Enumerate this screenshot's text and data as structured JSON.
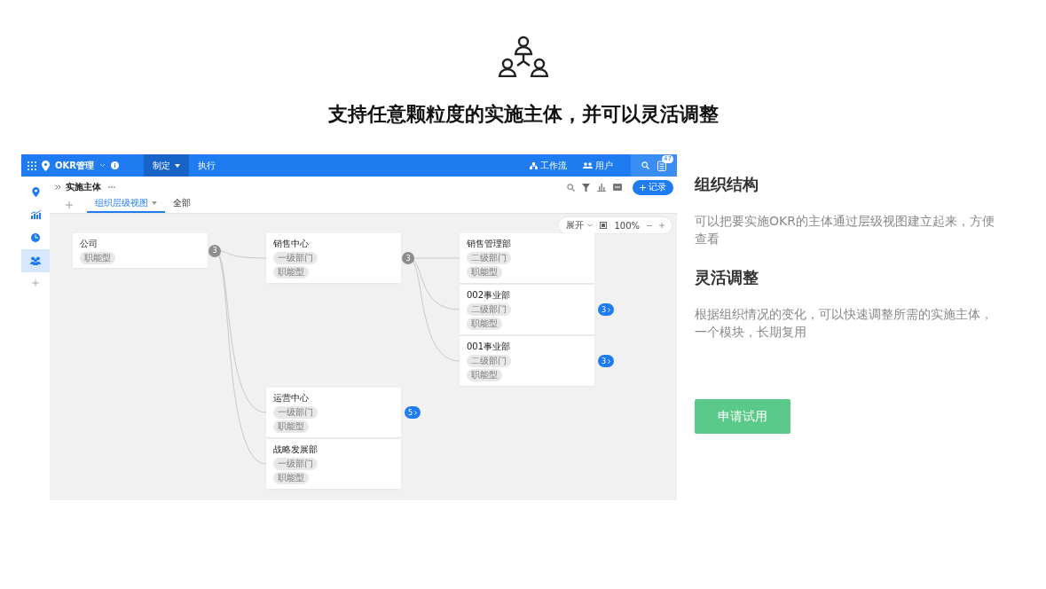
{
  "hero": {
    "title": "支持任意颗粒度的实施主体，并可以灵活调整"
  },
  "app": {
    "brand": "OKR管理",
    "nav": [
      {
        "label": "制定",
        "selected": true
      },
      {
        "label": "执行",
        "selected": false
      }
    ],
    "top_links": [
      {
        "kind": "workflow",
        "label": "工作流"
      },
      {
        "kind": "users",
        "label": "用户"
      }
    ],
    "notification_count": "47",
    "sidebar": [
      {
        "kind": "pin",
        "selected": false
      },
      {
        "kind": "chart",
        "selected": false
      },
      {
        "kind": "pie",
        "selected": false
      },
      {
        "kind": "people",
        "selected": true
      }
    ],
    "page_title": "实施主体",
    "record_button": "记录",
    "tabs": [
      {
        "label": "组织层级视图",
        "selected": true
      },
      {
        "label": "全部",
        "selected": false
      }
    ],
    "zoom": {
      "expand": "展开",
      "percent": "100%"
    },
    "tree": [
      {
        "name": "公司",
        "tags": [
          "职能型"
        ],
        "count": "3",
        "expanded": true,
        "children": [
          {
            "name": "销售中心",
            "tags": [
              "一级部门",
              "职能型"
            ],
            "count": "3",
            "expanded": true,
            "children": [
              {
                "name": "销售管理部",
                "tags": [
                  "二级部门",
                  "职能型"
                ]
              },
              {
                "name": "002事业部",
                "tags": [
                  "二级部门",
                  "职能型"
                ],
                "count": "3",
                "expanded": false
              },
              {
                "name": "001事业部",
                "tags": [
                  "二级部门",
                  "职能型"
                ],
                "count": "3",
                "expanded": false
              }
            ]
          },
          {
            "name": "运营中心",
            "tags": [
              "一级部门",
              "职能型"
            ],
            "count": "5",
            "expanded": false
          },
          {
            "name": "战略发展部",
            "tags": [
              "一级部门",
              "职能型"
            ]
          }
        ]
      }
    ]
  },
  "features": [
    {
      "heading": "组织结构",
      "text": "可以把要实施OKR的主体通过层级视图建立起来，方便查看"
    },
    {
      "heading": "灵活调整",
      "text": "根据组织情况的变化，可以快速调整所需的实施主体，一个模块，长期复用"
    }
  ],
  "cta": "申请试用"
}
